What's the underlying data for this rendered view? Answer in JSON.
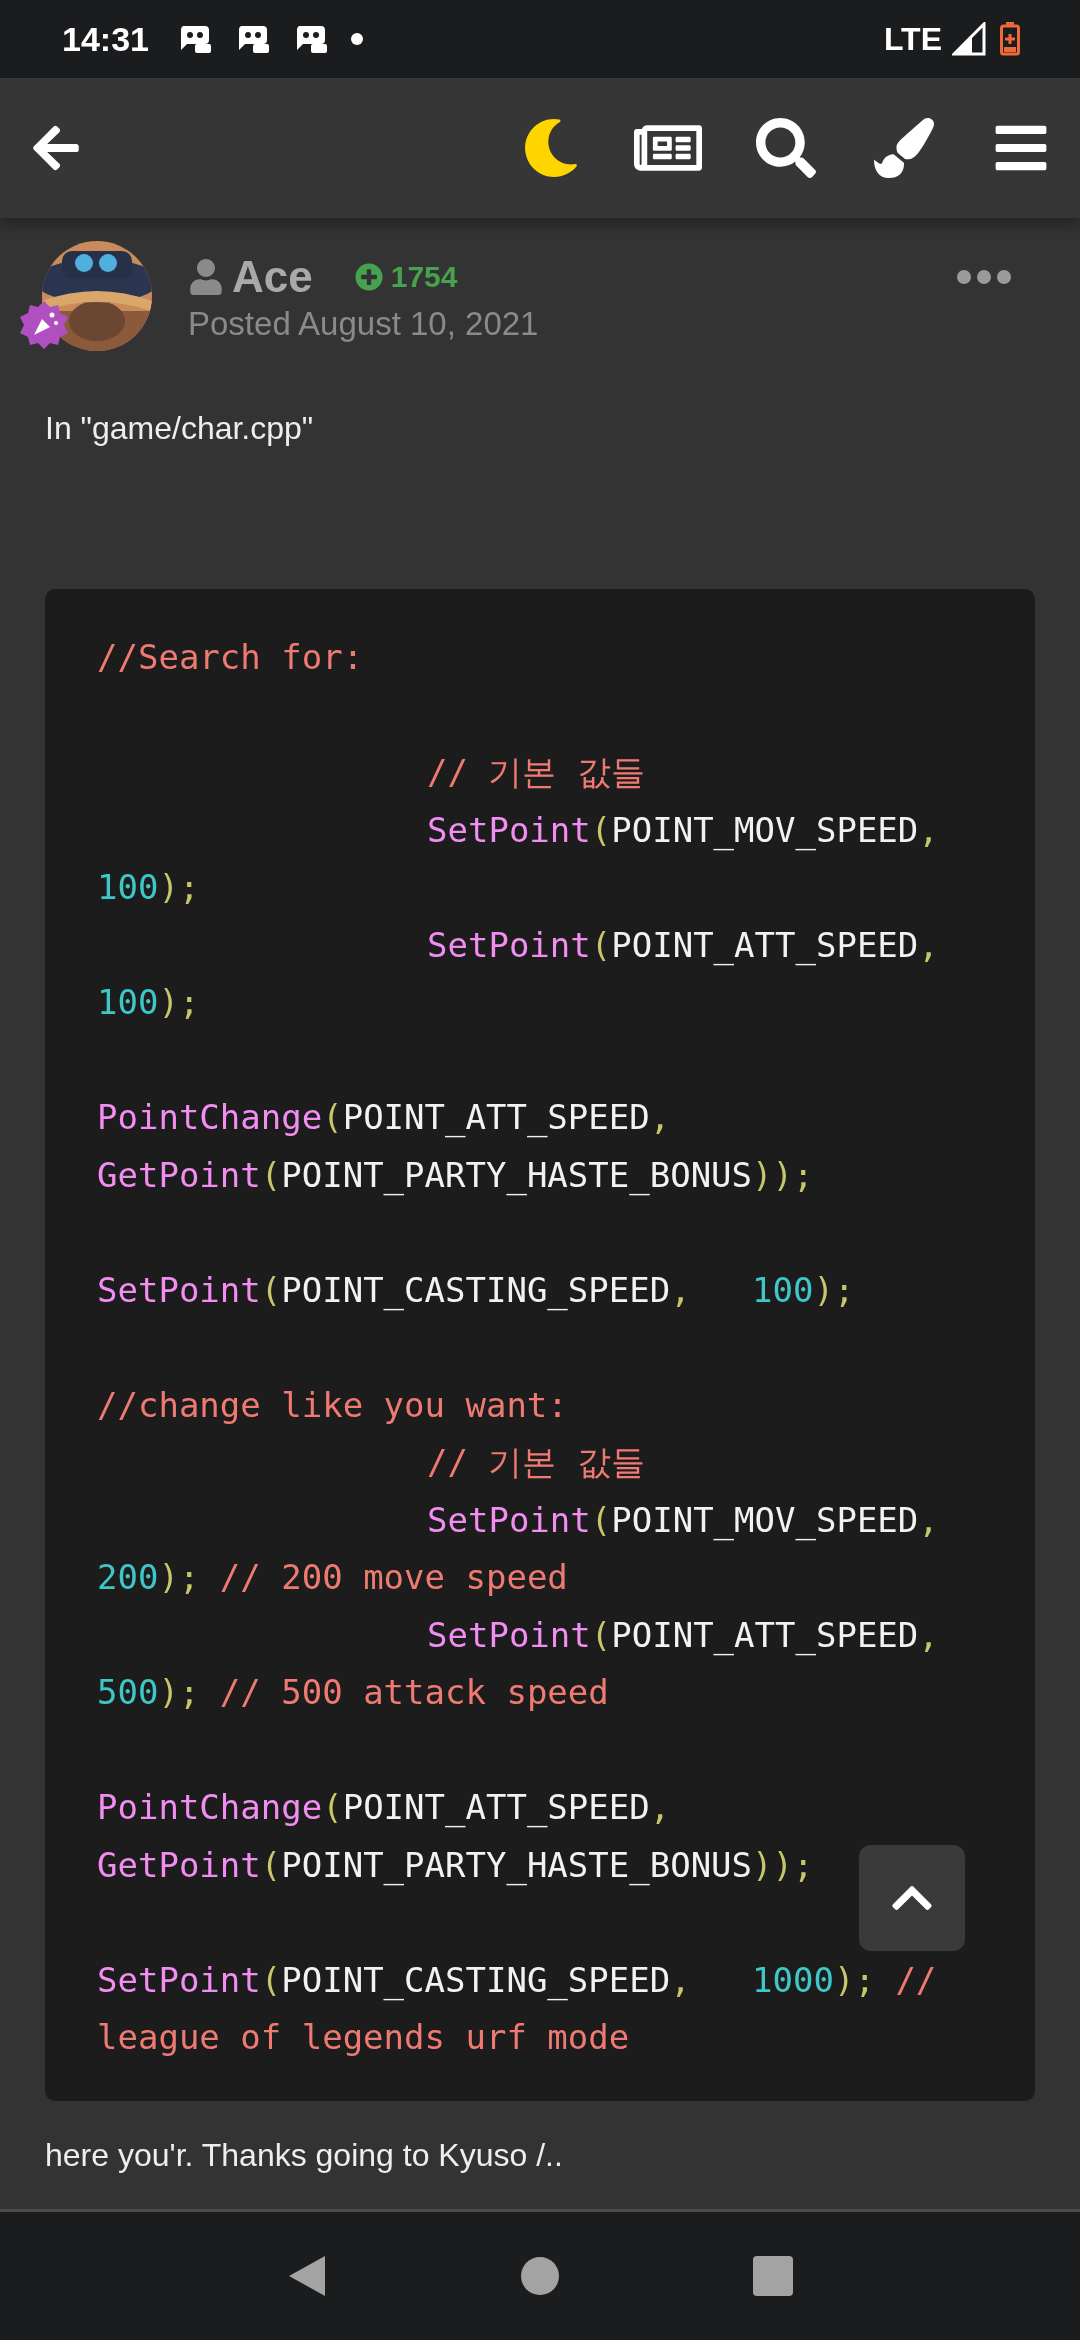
{
  "status_bar": {
    "time": "14:31",
    "network": "LTE"
  },
  "post": {
    "author": "Ace",
    "reputation": "1754",
    "date": "Posted August 10, 2021",
    "intro": "In \"game/char.cpp\"",
    "code_lines": [
      {
        "kind": "code",
        "indent": false,
        "tokens": [
          {
            "kind": "comment",
            "text": "//Search for:"
          }
        ]
      },
      {
        "kind": "blank"
      },
      {
        "kind": "code",
        "indent": true,
        "tokens": [
          {
            "kind": "comment",
            "text": "// 기본 값들"
          }
        ]
      },
      {
        "kind": "code",
        "indent": true,
        "tokens": [
          {
            "kind": "func",
            "text": "SetPoint"
          },
          {
            "kind": "paren",
            "text": "("
          },
          {
            "kind": "ident",
            "text": "POINT_MOV_SPEED"
          },
          {
            "kind": "paren",
            "text": ","
          }
        ]
      },
      {
        "kind": "code",
        "indent": false,
        "tokens": [
          {
            "kind": "num",
            "text": "100"
          },
          {
            "kind": "paren",
            "text": ");"
          }
        ]
      },
      {
        "kind": "code",
        "indent": true,
        "tokens": [
          {
            "kind": "func",
            "text": "SetPoint"
          },
          {
            "kind": "paren",
            "text": "("
          },
          {
            "kind": "ident",
            "text": "POINT_ATT_SPEED"
          },
          {
            "kind": "paren",
            "text": ","
          }
        ]
      },
      {
        "kind": "code",
        "indent": false,
        "tokens": [
          {
            "kind": "num",
            "text": "100"
          },
          {
            "kind": "paren",
            "text": ");"
          }
        ]
      },
      {
        "kind": "blank"
      },
      {
        "kind": "code",
        "indent": false,
        "tokens": [
          {
            "kind": "func",
            "text": "PointChange"
          },
          {
            "kind": "paren",
            "text": "("
          },
          {
            "kind": "ident",
            "text": "POINT_ATT_SPEED"
          },
          {
            "kind": "paren",
            "text": ","
          }
        ]
      },
      {
        "kind": "code",
        "indent": false,
        "tokens": [
          {
            "kind": "func",
            "text": "GetPoint"
          },
          {
            "kind": "paren",
            "text": "("
          },
          {
            "kind": "ident",
            "text": "POINT_PARTY_HASTE_BONUS"
          },
          {
            "kind": "paren",
            "text": "));"
          }
        ]
      },
      {
        "kind": "blank"
      },
      {
        "kind": "code",
        "indent": false,
        "tokens": [
          {
            "kind": "func",
            "text": "SetPoint"
          },
          {
            "kind": "paren",
            "text": "("
          },
          {
            "kind": "ident",
            "text": "POINT_CASTING_SPEED"
          },
          {
            "kind": "paren",
            "text": ",   "
          },
          {
            "kind": "num",
            "text": "100"
          },
          {
            "kind": "paren",
            "text": ");"
          }
        ]
      },
      {
        "kind": "blank"
      },
      {
        "kind": "code",
        "indent": false,
        "tokens": [
          {
            "kind": "comment",
            "text": "//change like you want:"
          }
        ]
      },
      {
        "kind": "code",
        "indent": true,
        "tokens": [
          {
            "kind": "comment",
            "text": "// 기본 값들"
          }
        ]
      },
      {
        "kind": "code",
        "indent": true,
        "tokens": [
          {
            "kind": "func",
            "text": "SetPoint"
          },
          {
            "kind": "paren",
            "text": "("
          },
          {
            "kind": "ident",
            "text": "POINT_MOV_SPEED"
          },
          {
            "kind": "paren",
            "text": ","
          }
        ]
      },
      {
        "kind": "code",
        "indent": false,
        "tokens": [
          {
            "kind": "num",
            "text": "200"
          },
          {
            "kind": "paren",
            "text": "); "
          },
          {
            "kind": "comment",
            "text": "// 200 move speed"
          }
        ]
      },
      {
        "kind": "code",
        "indent": true,
        "tokens": [
          {
            "kind": "func",
            "text": "SetPoint"
          },
          {
            "kind": "paren",
            "text": "("
          },
          {
            "kind": "ident",
            "text": "POINT_ATT_SPEED"
          },
          {
            "kind": "paren",
            "text": ","
          }
        ]
      },
      {
        "kind": "code",
        "indent": false,
        "tokens": [
          {
            "kind": "num",
            "text": "500"
          },
          {
            "kind": "paren",
            "text": "); "
          },
          {
            "kind": "comment",
            "text": "// 500 attack speed"
          }
        ]
      },
      {
        "kind": "blank"
      },
      {
        "kind": "code",
        "indent": false,
        "tokens": [
          {
            "kind": "func",
            "text": "PointChange"
          },
          {
            "kind": "paren",
            "text": "("
          },
          {
            "kind": "ident",
            "text": "POINT_ATT_SPEED"
          },
          {
            "kind": "paren",
            "text": ","
          }
        ]
      },
      {
        "kind": "code",
        "indent": false,
        "tokens": [
          {
            "kind": "func",
            "text": "GetPoint"
          },
          {
            "kind": "paren",
            "text": "("
          },
          {
            "kind": "ident",
            "text": "POINT_PARTY_HASTE_BONUS"
          },
          {
            "kind": "paren",
            "text": "));"
          }
        ]
      },
      {
        "kind": "blank"
      },
      {
        "kind": "code",
        "indent": false,
        "tokens": [
          {
            "kind": "func",
            "text": "SetPoint"
          },
          {
            "kind": "paren",
            "text": "("
          },
          {
            "kind": "ident",
            "text": "POINT_CASTING_SPEED"
          },
          {
            "kind": "paren",
            "text": ",   "
          },
          {
            "kind": "num",
            "text": "1000"
          },
          {
            "kind": "paren",
            "text": "); "
          },
          {
            "kind": "comment",
            "text": "//"
          }
        ]
      },
      {
        "kind": "code",
        "indent": false,
        "tokens": [
          {
            "kind": "comment",
            "text": "league of legends urf mode"
          }
        ]
      }
    ],
    "outro": "here you'r. Thanks going to Kyuso /.."
  }
}
